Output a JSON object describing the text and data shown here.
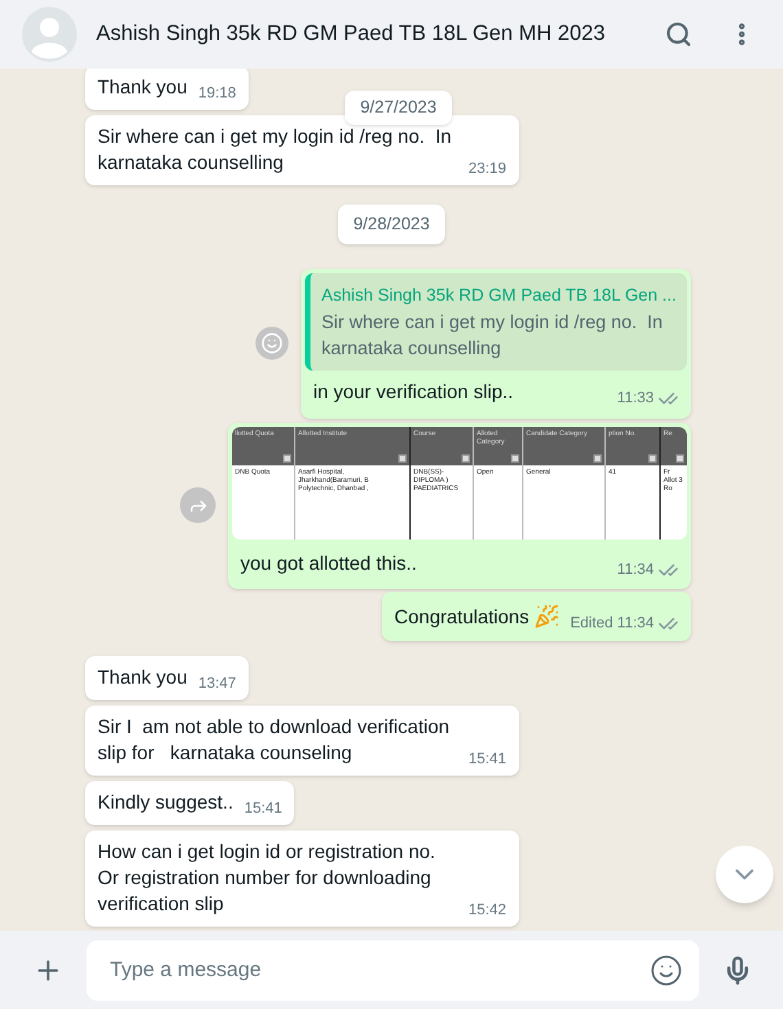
{
  "chat": {
    "title": "Ashish Singh 35k RD GM Paed TB 18L Gen MH 2023"
  },
  "sticky_date": "9/27/2023",
  "messages": [
    {
      "kind": "text",
      "outgoing": false,
      "text": "Thank you",
      "time": "19:18"
    },
    {
      "kind": "text",
      "outgoing": false,
      "text": "Sir where can i get my login id /reg no.  In karnataka counselling",
      "time": "23:19"
    },
    {
      "kind": "date",
      "text": "9/28/2023"
    },
    {
      "kind": "reply",
      "outgoing": true,
      "quote_author": "Ashish Singh 35k RD GM Paed TB 18L Gen ...",
      "quote_text": "Sir where can i get my login id /reg no.  In karnataka counselling",
      "text": "in your verification slip..",
      "time": "11:33",
      "read": false
    },
    {
      "kind": "image",
      "outgoing": true,
      "table": {
        "columns": [
          "llotted Quota",
          "Allotted Institute",
          "Course",
          "Alloted Category",
          "Candidate Category",
          "ption No.",
          "Re"
        ],
        "rows": [
          [
            "DNB Quota",
            "Asarfi Hospital, Jharkhand(Baramuri, B Polytechnic, Dhanbad ,",
            "DNB(SS)-DIPLOMA ) PAEDIATRICS",
            "Open",
            "General",
            "41",
            "Fr Allot 3 Ro"
          ]
        ]
      },
      "caption": "you got allotted this..",
      "time": "11:34",
      "read": false
    },
    {
      "kind": "text",
      "outgoing": true,
      "text": "Congratulations",
      "emoji": true,
      "edited": "Edited",
      "time": "11:34",
      "read": false
    },
    {
      "kind": "text",
      "outgoing": false,
      "text": "Thank you",
      "time": "13:47"
    },
    {
      "kind": "text",
      "outgoing": false,
      "text": "Sir I  am not able to download verification slip for   karnataka counseling",
      "time": "15:41"
    },
    {
      "kind": "text",
      "outgoing": false,
      "text": "Kindly suggest..",
      "time": "15:41"
    },
    {
      "kind": "text",
      "outgoing": false,
      "text": "How can i get login id or registration no. Or registration number for downloading verification slip",
      "time": "15:42"
    }
  ],
  "composer": {
    "placeholder": "Type a message"
  }
}
